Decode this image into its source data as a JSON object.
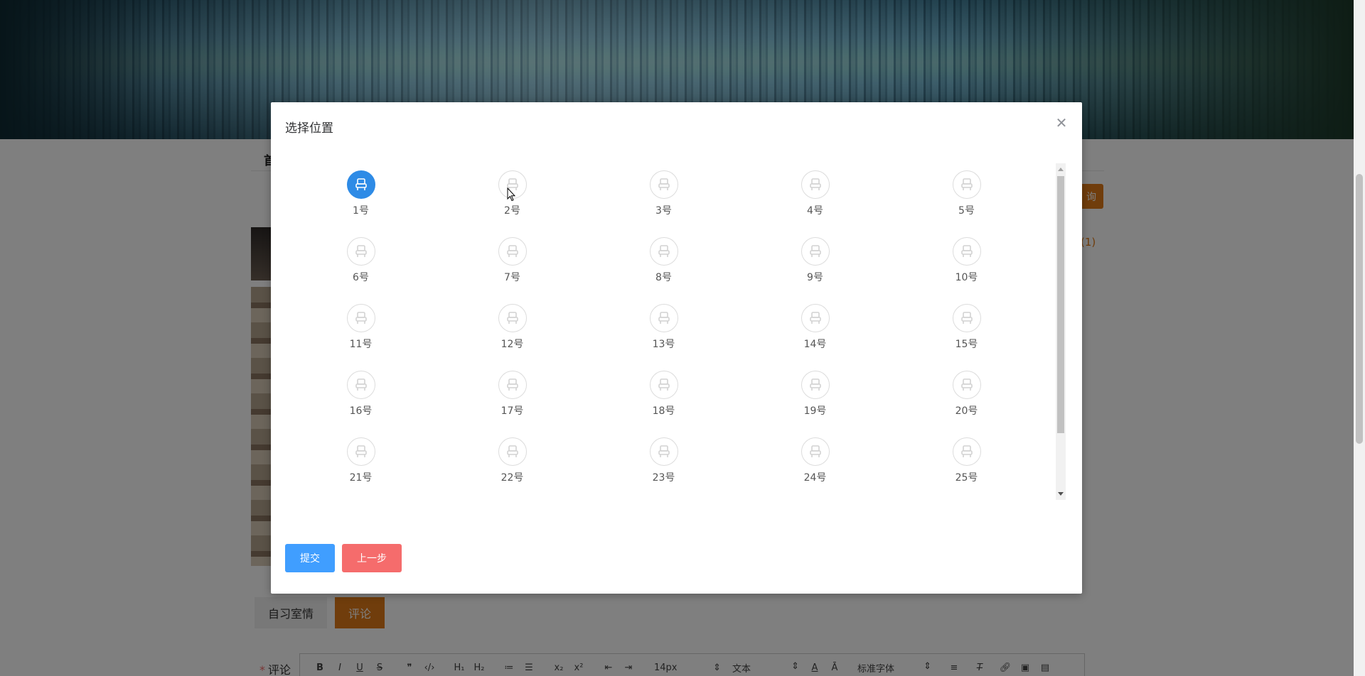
{
  "background": {
    "nav_first_char": "首",
    "orange_button_label": "询",
    "orange_count": "(1)",
    "tabs": [
      {
        "label": "自习室情"
      },
      {
        "label": "评论"
      }
    ],
    "comment_label": "评论",
    "editor_toolbar": {
      "font_size": "14px",
      "block_format": "文本",
      "font_family": "标准字体"
    }
  },
  "modal": {
    "title": "选择位置",
    "close_icon": "close-icon",
    "selected_seat": "1号",
    "seats": [
      {
        "label": "1号"
      },
      {
        "label": "2号"
      },
      {
        "label": "3号"
      },
      {
        "label": "4号"
      },
      {
        "label": "5号"
      },
      {
        "label": "6号"
      },
      {
        "label": "7号"
      },
      {
        "label": "8号"
      },
      {
        "label": "9号"
      },
      {
        "label": "10号"
      },
      {
        "label": "11号"
      },
      {
        "label": "12号"
      },
      {
        "label": "13号"
      },
      {
        "label": "14号"
      },
      {
        "label": "15号"
      },
      {
        "label": "16号"
      },
      {
        "label": "17号"
      },
      {
        "label": "18号"
      },
      {
        "label": "19号"
      },
      {
        "label": "20号"
      },
      {
        "label": "21号"
      },
      {
        "label": "22号"
      },
      {
        "label": "23号"
      },
      {
        "label": "24号"
      },
      {
        "label": "25号"
      }
    ],
    "submit_label": "提交",
    "back_label": "上一步"
  },
  "colors": {
    "accent_orange": "#e07b18",
    "primary_blue": "#409eff",
    "selected_seat_blue": "#2e8be6",
    "danger_red": "#f56c6c"
  }
}
